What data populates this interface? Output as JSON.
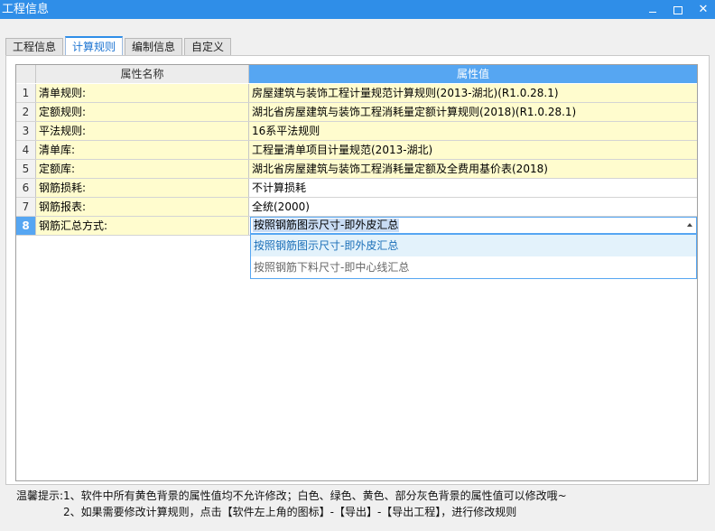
{
  "window": {
    "title": "工程信息",
    "controls": {
      "minimize": "",
      "maximize": "",
      "close": "✕"
    }
  },
  "tabs": [
    {
      "label": "工程信息",
      "active": false
    },
    {
      "label": "计算规则",
      "active": true
    },
    {
      "label": "编制信息",
      "active": false
    },
    {
      "label": "自定义",
      "active": false
    }
  ],
  "grid": {
    "headers": {
      "name": "属性名称",
      "value": "属性值"
    },
    "rows": [
      {
        "num": "1",
        "name": "清单规则:",
        "value": "房屋建筑与装饰工程计量规范计算规则(2013-湖北)(R1.0.28.1)",
        "bg": "yellow"
      },
      {
        "num": "2",
        "name": "定额规则:",
        "value": "湖北省房屋建筑与装饰工程消耗量定额计算规则(2018)(R1.0.28.1)",
        "bg": "yellow"
      },
      {
        "num": "3",
        "name": "平法规则:",
        "value": "16系平法规则",
        "bg": "yellow"
      },
      {
        "num": "4",
        "name": "清单库:",
        "value": "工程量清单项目计量规范(2013-湖北)",
        "bg": "yellow"
      },
      {
        "num": "5",
        "name": "定额库:",
        "value": "湖北省房屋建筑与装饰工程消耗量定额及全费用基价表(2018)",
        "bg": "yellow"
      },
      {
        "num": "6",
        "name": "钢筋损耗:",
        "value": "不计算损耗",
        "bg": "white"
      },
      {
        "num": "7",
        "name": "钢筋报表:",
        "value": "全统(2000)",
        "bg": "white"
      },
      {
        "num": "8",
        "name": "钢筋汇总方式:",
        "value": "按照钢筋图示尺寸-即外皮汇总",
        "bg": "yellow",
        "selected": true
      }
    ]
  },
  "dropdown": {
    "selected": "按照钢筋图示尺寸-即外皮汇总",
    "options": [
      "按照钢筋图示尺寸-即外皮汇总",
      "按照钢筋下料尺寸-即中心线汇总"
    ]
  },
  "tips": {
    "line1": "温馨提示:1、软件中所有黄色背景的属性值均不允许修改；白色、绿色、黄色、部分灰色背景的属性值可以修改哦~",
    "line2": "2、如果需要修改计算规则，点击【软件左上角的图标】-【导出】-【导出工程】，进行修改规则"
  },
  "colors": {
    "titlebar": "#2f8ee8",
    "header_value": "#56a6f2",
    "locked_row": "#fffcce",
    "hover_option": "#e3f2fb"
  }
}
